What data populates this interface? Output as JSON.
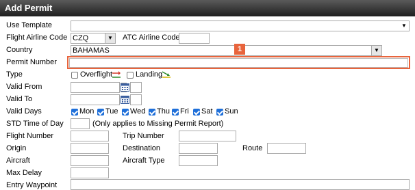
{
  "window": {
    "title": "Add Permit"
  },
  "form": {
    "use_template": {
      "label": "Use Template",
      "value": ""
    },
    "flight_airline_code": {
      "label": "Flight Airline Code",
      "value": "CZQ"
    },
    "atc_airline_code": {
      "label": "ATC Airline Code",
      "value": ""
    },
    "country": {
      "label": "Country",
      "value": "BAHAMAS"
    },
    "permit_number": {
      "label": "Permit Number",
      "value": ""
    },
    "type": {
      "label": "Type",
      "options": [
        {
          "label": "Overflight",
          "checked": false
        },
        {
          "label": "Landing",
          "checked": false
        }
      ]
    },
    "valid_from": {
      "label": "Valid From"
    },
    "valid_to": {
      "label": "Valid To"
    },
    "valid_days": {
      "label": "Valid Days",
      "days": [
        {
          "label": "Mon",
          "checked": true
        },
        {
          "label": "Tue",
          "checked": true
        },
        {
          "label": "Wed",
          "checked": true
        },
        {
          "label": "Thu",
          "checked": true
        },
        {
          "label": "Fri",
          "checked": true
        },
        {
          "label": "Sat",
          "checked": true
        },
        {
          "label": "Sun",
          "checked": true
        }
      ]
    },
    "std_time_of_day": {
      "label": "STD Time of Day",
      "note": "(Only applies to Missing Permit Report)"
    },
    "flight_number": {
      "label": "Flight Number"
    },
    "trip_number": {
      "label": "Trip Number"
    },
    "origin": {
      "label": "Origin"
    },
    "destination": {
      "label": "Destination"
    },
    "route": {
      "label": "Route"
    },
    "aircraft": {
      "label": "Aircraft"
    },
    "aircraft_type": {
      "label": "Aircraft Type"
    },
    "max_delay": {
      "label": "Max Delay"
    },
    "entry_waypoint": {
      "label": "Entry Waypoint"
    }
  },
  "annotation": {
    "badge": "1",
    "color": "#e8643c"
  }
}
